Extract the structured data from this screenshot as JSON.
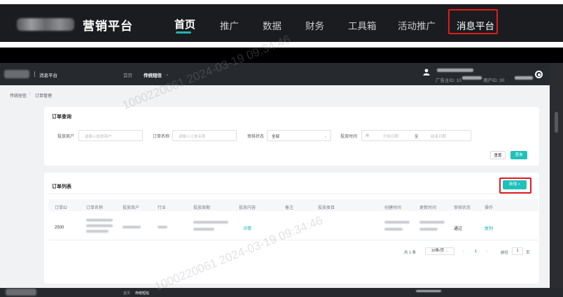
{
  "top_nav": {
    "brand": "营销平台",
    "items": [
      "首页",
      "推广",
      "数据",
      "财务",
      "工具箱",
      "活动推广",
      "消息平台"
    ],
    "active_index": 0
  },
  "inner_header": {
    "title": "消息平台",
    "nav_home": "首页",
    "nav_current": "传统短信",
    "advertiser_prefix": "广告主ID: 10",
    "user_prefix": "用户ID: 30"
  },
  "breadcrumb": {
    "root": "传统短信",
    "separator": "/",
    "current": "订单管理"
  },
  "query_card": {
    "title": "订单查询",
    "fields": [
      {
        "label": "投放商户",
        "placeholder": "请输入投放商户"
      },
      {
        "label": "订单名称",
        "placeholder": "请输入订单名称"
      },
      {
        "label": "审核状态",
        "value": "全部"
      },
      {
        "label": "投放时间",
        "start_placeholder": "开始日期",
        "range_sep": "至",
        "end_placeholder": "结束日期"
      }
    ],
    "reset_label": "重置",
    "search_label": "查询"
  },
  "list_card": {
    "title": "订单列表",
    "new_label": "新增",
    "columns": [
      "订单ID",
      "订单名称",
      "投放商户",
      "行业",
      "投放周期",
      "投放内容",
      "备注",
      "投放类目",
      "创建时间",
      "更新时间",
      "审核状态",
      "操作"
    ],
    "rows": [
      {
        "id": "2500",
        "content_link": "详情",
        "status": "通过",
        "action": "复制"
      }
    ]
  },
  "pagination": {
    "total": "共 1 条",
    "page_size": "10条/页",
    "current_page": "1",
    "goto_label": "前往",
    "goto_value": "1",
    "page_unit": "页"
  },
  "watermark": "1000220061 2024-03-19 09:34:46",
  "bottom_bar": {
    "nav_home": "首页",
    "nav_current": "传统短信"
  },
  "colors": {
    "accent": "#1fc1bb",
    "highlight": "#e21b1b",
    "nav_bg": "#1a1c1f"
  }
}
